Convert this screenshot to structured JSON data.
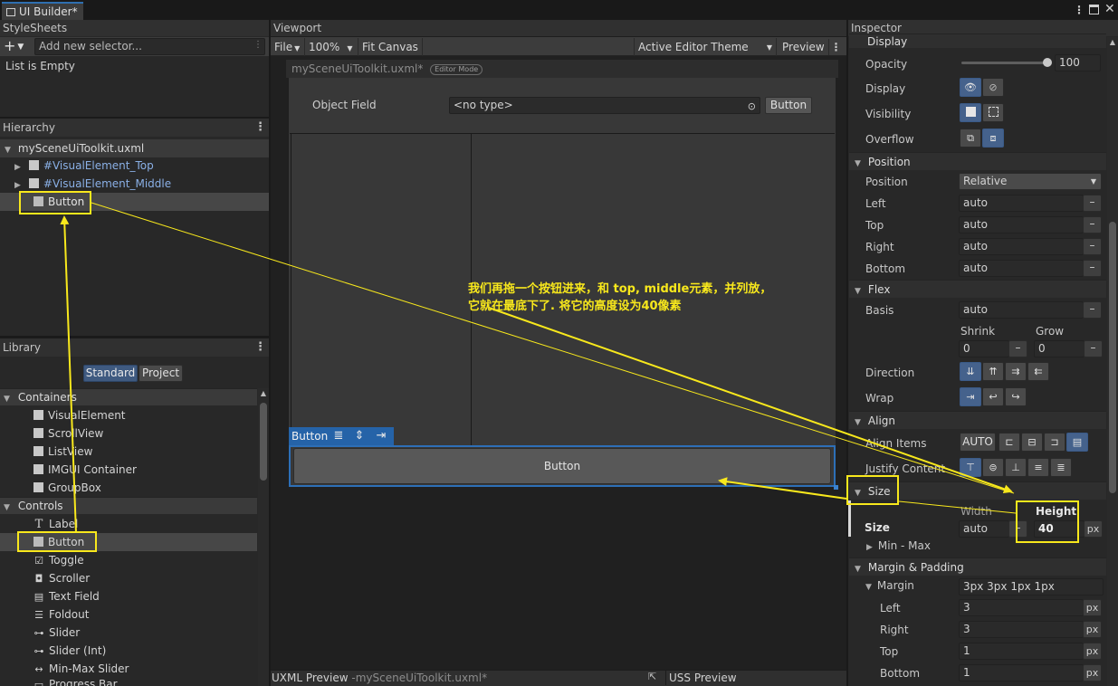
{
  "window": {
    "tab_title": "UI Builder*"
  },
  "stylesheets": {
    "title": "StyleSheets",
    "add_placeholder": "Add new selector...",
    "empty_text": "List is Empty"
  },
  "hierarchy": {
    "title": "Hierarchy",
    "root": "mySceneUiToolkit.uxml",
    "items": [
      "#VisualElement_Top",
      "#VisualElement_Middle",
      "Button"
    ]
  },
  "library": {
    "title": "Library",
    "tabs": [
      "Standard",
      "Project"
    ],
    "categories": {
      "containers": {
        "label": "Containers",
        "items": [
          "VisualElement",
          "ScrollView",
          "ListView",
          "IMGUI Container",
          "GroupBox"
        ]
      },
      "controls": {
        "label": "Controls",
        "items": [
          "Label",
          "Button",
          "Toggle",
          "Scroller",
          "Text Field",
          "Foldout",
          "Slider",
          "Slider (Int)",
          "Min-Max Slider",
          "Progress Bar"
        ]
      }
    }
  },
  "viewport": {
    "title": "Viewport",
    "toolbar": {
      "file": "File",
      "zoom": "100%",
      "fit": "Fit Canvas",
      "theme": "Active Editor Theme",
      "preview": "Preview"
    },
    "canvas_title": "mySceneUiToolkit.uxml*",
    "canvas_mode": "Editor Mode",
    "object_field_label": "Object Field",
    "object_field_value": "<no type>",
    "object_field_button": "Button",
    "selected_label": "Button",
    "canvas_button": "Button"
  },
  "bottom": {
    "uxml_label": "UXML Preview",
    "uxml_file": "-mySceneUiToolkit.uxml*",
    "uss_label": "USS Preview"
  },
  "inspector": {
    "title": "Inspector",
    "display": {
      "header": "Display",
      "opacity_label": "Opacity",
      "opacity_value": "100",
      "opacity_level": 1.0,
      "display_label": "Display",
      "visibility_label": "Visibility",
      "overflow_label": "Overflow"
    },
    "position": {
      "header": "Position",
      "position_label": "Position",
      "position_value": "Relative",
      "left_label": "Left",
      "left_value": "auto",
      "top_label": "Top",
      "top_value": "auto",
      "right_label": "Right",
      "right_value": "auto",
      "bottom_label": "Bottom",
      "bottom_value": "auto"
    },
    "flex": {
      "header": "Flex",
      "basis_label": "Basis",
      "basis_value": "auto",
      "shrink_label": "Shrink",
      "shrink_value": "0",
      "grow_label": "Grow",
      "grow_value": "0",
      "direction_label": "Direction",
      "wrap_label": "Wrap"
    },
    "align": {
      "header": "Align",
      "align_items_label": "Align Items",
      "align_auto": "AUTO",
      "justify_label": "Justify Content"
    },
    "size": {
      "header": "Size",
      "size_label": "Size",
      "width_label": "Width",
      "width_value": "auto",
      "height_label": "Height",
      "height_value": "40",
      "height_unit": "px",
      "minmax_label": "Min - Max"
    },
    "margin": {
      "header": "Margin & Padding",
      "margin_label": "Margin",
      "margin_value": "3px 3px 1px 1px",
      "left_label": "Left",
      "left_value": "3",
      "right_label": "Right",
      "right_value": "3",
      "top_label": "Top",
      "top_value": "1",
      "bottom_label": "Bottom",
      "bottom_value": "1",
      "unit": "px"
    }
  },
  "annotation": {
    "line1": "我们再拖一个按钮进来，和 top, middle元素，并列放，",
    "line2": "它就在最底下了. 将它的高度设为40像素",
    "color": "#f8e81c"
  }
}
